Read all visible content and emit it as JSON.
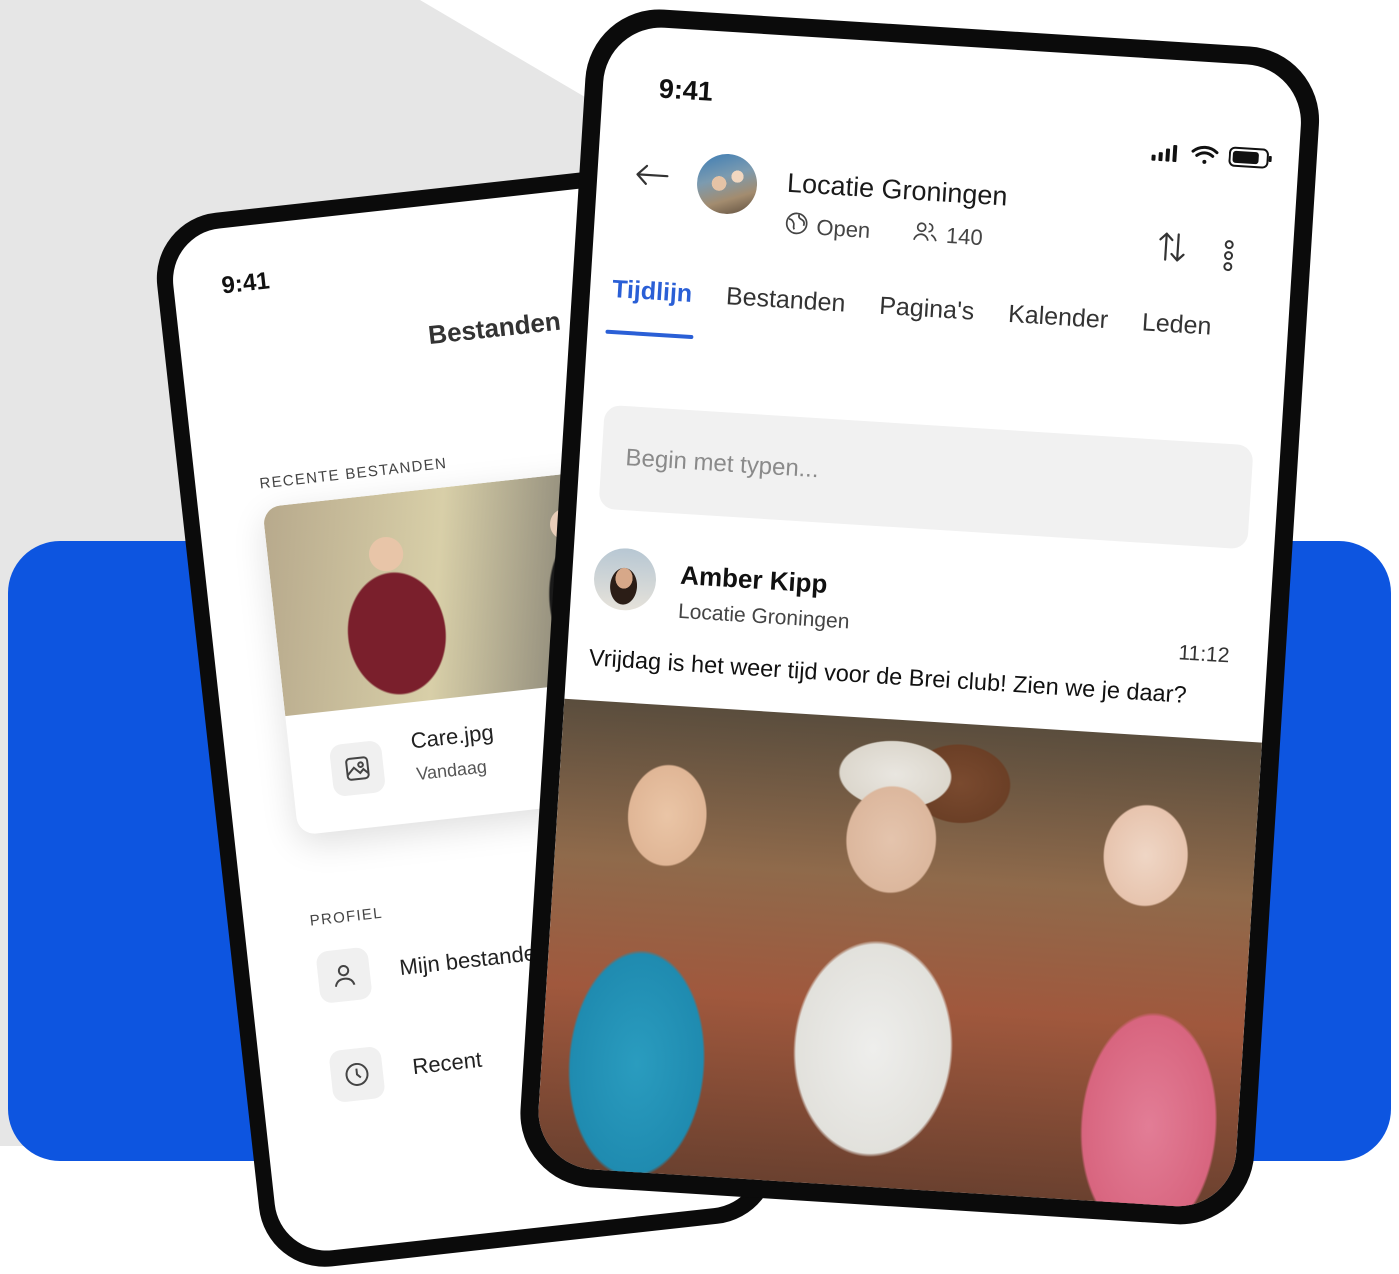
{
  "back_phone": {
    "time": "9:41",
    "title": "Bestanden",
    "recent_label": "RECENTE BESTANDEN",
    "recent_file": {
      "name": "Care.jpg",
      "date": "Vandaag",
      "icon": "image-icon"
    },
    "profile_label": "PROFIEL",
    "menu": [
      {
        "label": "Mijn bestanden",
        "icon": "person-icon"
      },
      {
        "label": "Recent",
        "icon": "clock-icon"
      }
    ]
  },
  "front_phone": {
    "time": "9:41",
    "group": {
      "name": "Locatie Groningen",
      "visibility": "Open",
      "members": "140"
    },
    "tabs": [
      "Tijdlijn",
      "Bestanden",
      "Pagina's",
      "Kalender",
      "Leden"
    ],
    "active_tab": "Tijdlijn",
    "compose_placeholder": "Begin met typen...",
    "post": {
      "author": "Amber Kipp",
      "location": "Locatie Groningen",
      "time": "11:12",
      "text": "Vrijdag is het weer tijd voor de Brei club! Zien we je daar?"
    }
  },
  "colors": {
    "accent": "#2a5fd6",
    "brand_blue": "#0d55e0",
    "background_gray": "#e6e6e6",
    "phone_frame": "#0b0b0b"
  }
}
